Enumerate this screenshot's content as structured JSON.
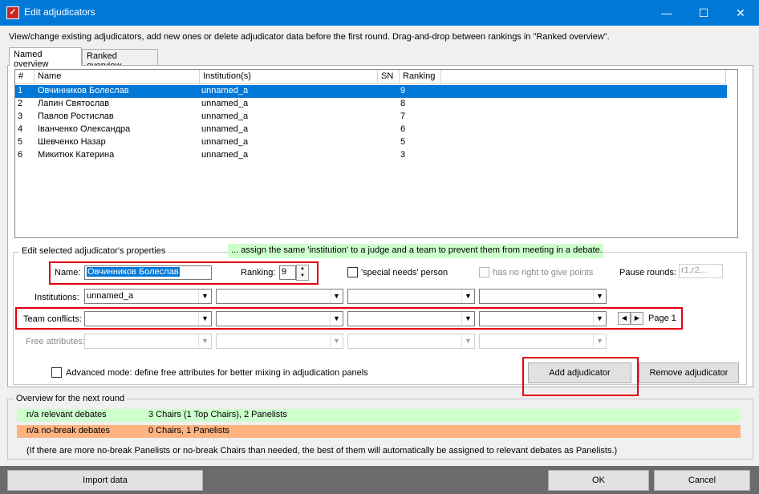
{
  "window": {
    "title": "Edit adjudicators",
    "icon": "app-icon",
    "minimize": "—",
    "maximize": "☐",
    "close": "✕"
  },
  "intro": "View/change existing adjudicators, add new ones or delete adjudicator data before the first round. Drag-and-drop between rankings in \"Ranked overview\".",
  "tabs": [
    {
      "label": "Named overview",
      "active": true
    },
    {
      "label": "Ranked overview",
      "active": false
    }
  ],
  "table": {
    "columns": [
      "#",
      "Name",
      "Institution(s)",
      "SN",
      "Ranking"
    ],
    "rows": [
      {
        "num": "1",
        "name": "Овчинников Болеслав",
        "institution": "unnamed_a",
        "sn": "",
        "ranking": "9",
        "selected": true
      },
      {
        "num": "2",
        "name": "Лапин Святослав",
        "institution": "unnamed_a",
        "sn": "",
        "ranking": "8",
        "selected": false
      },
      {
        "num": "3",
        "name": "Павлов Ростислав",
        "institution": "unnamed_a",
        "sn": "",
        "ranking": "7",
        "selected": false
      },
      {
        "num": "4",
        "name": "Іванченко Олександра",
        "institution": "unnamed_a",
        "sn": "",
        "ranking": "6",
        "selected": false
      },
      {
        "num": "5",
        "name": "Шевченко Назар",
        "institution": "unnamed_a",
        "sn": "",
        "ranking": "5",
        "selected": false
      },
      {
        "num": "6",
        "name": "Микитюк Катерина",
        "institution": "unnamed_a",
        "sn": "",
        "ranking": "3",
        "selected": false
      }
    ]
  },
  "props": {
    "group_title": "Edit selected adjudicator's properties",
    "hint": "... assign the same 'institution' to a judge and a team to prevent them from meeting in a debate.",
    "name_label": "Name:",
    "name_value": "Овчинников Болеслав",
    "ranking_label": "Ranking:",
    "ranking_value": "9",
    "special_needs_label": "'special needs' person",
    "no_right_label": "has no right to give points",
    "pause_label": "Pause rounds:",
    "pause_placeholder": "r1,r2,..",
    "institutions_label": "Institutions:",
    "institutions_value": "unnamed_a",
    "team_conflicts_label": "Team conflicts:",
    "page_label": "Page 1",
    "free_attributes_label": "Free attributes:",
    "advanced_label": "Advanced mode: define free attributes for better mixing in adjudication panels",
    "add_button": "Add adjudicator",
    "remove_button": "Remove adjudicator"
  },
  "overview": {
    "title": "Overview for the next round",
    "relevant_label": "n/a relevant debates",
    "relevant_value": "3 Chairs (1 Top Chairs), 2 Panelists",
    "nobreak_label": "n/a no-break debates",
    "nobreak_value": "0 Chairs, 1 Panelists",
    "note": "(If there are more no-break Panelists or no-break Chairs than needed, the best of them will automatically be assigned to relevant debates as Panelists.)",
    "colors": {
      "relevant": "#ccffcc",
      "nobreak": "#ffb380"
    }
  },
  "footer": {
    "import_button": "Import data",
    "ok_button": "OK",
    "cancel_button": "Cancel"
  }
}
